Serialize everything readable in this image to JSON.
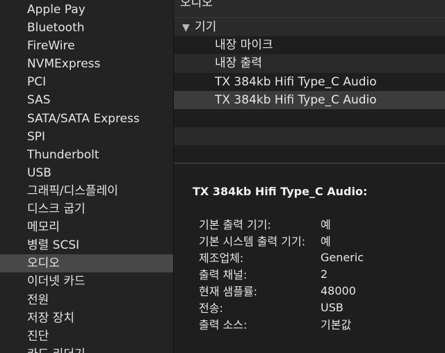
{
  "sidebar": {
    "items": [
      {
        "label": "Apple Pay"
      },
      {
        "label": "Bluetooth"
      },
      {
        "label": "FireWire"
      },
      {
        "label": "NVMExpress"
      },
      {
        "label": "PCI"
      },
      {
        "label": "SAS"
      },
      {
        "label": "SATA/SATA Express"
      },
      {
        "label": "SPI"
      },
      {
        "label": "Thunderbolt"
      },
      {
        "label": "USB"
      },
      {
        "label": "그래픽/디스플레이"
      },
      {
        "label": "디스크 굽기"
      },
      {
        "label": "메모리"
      },
      {
        "label": "병렬 SCSI"
      },
      {
        "label": "오디오"
      },
      {
        "label": "이더넷 카드"
      },
      {
        "label": "전원"
      },
      {
        "label": "저장 장치"
      },
      {
        "label": "진단"
      },
      {
        "label": "카드 리더기"
      }
    ],
    "selected_label": "오디오"
  },
  "header": {
    "title": "오디오"
  },
  "tree": {
    "group_label": "기기",
    "group_icon": "disclosure-triangle-down-icon",
    "items": [
      {
        "label": "내장 마이크"
      },
      {
        "label": "내장 출력"
      },
      {
        "label": "TX 384kb Hifi Type_C Audio"
      },
      {
        "label": "TX 384kb Hifi Type_C Audio"
      }
    ]
  },
  "detail": {
    "title": "TX 384kb Hifi Type_C Audio:",
    "properties": [
      {
        "key": "기본 출력 기기:",
        "value": "예"
      },
      {
        "key": "기본 시스템 출력 기기:",
        "value": "예"
      },
      {
        "key": "제조업체:",
        "value": "Generic"
      },
      {
        "key": "출력 채널:",
        "value": "2"
      },
      {
        "key": "현재 샘플률:",
        "value": "48000"
      },
      {
        "key": "전송:",
        "value": "USB"
      },
      {
        "key": "출력 소스:",
        "value": "기본값"
      }
    ]
  }
}
